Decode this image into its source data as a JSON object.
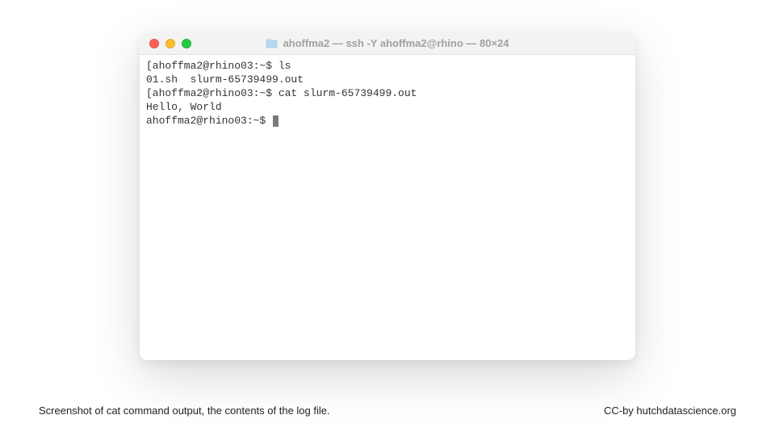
{
  "window": {
    "title": "ahoffma2 — ssh -Y ahoffma2@rhino — 80×24"
  },
  "terminal": {
    "lines": [
      "[ahoffma2@rhino03:~$ ls",
      "01.sh  slurm-65739499.out",
      "[ahoffma2@rhino03:~$ cat slurm-65739499.out",
      "Hello, World"
    ],
    "prompt": "ahoffma2@rhino03:~$ "
  },
  "caption": "Screenshot of cat command output, the contents of the log file.",
  "attribution": "CC-by hutchdatascience.org",
  "colors": {
    "close": "#ff5f57",
    "minimize": "#febc2e",
    "maximize": "#28c840"
  }
}
